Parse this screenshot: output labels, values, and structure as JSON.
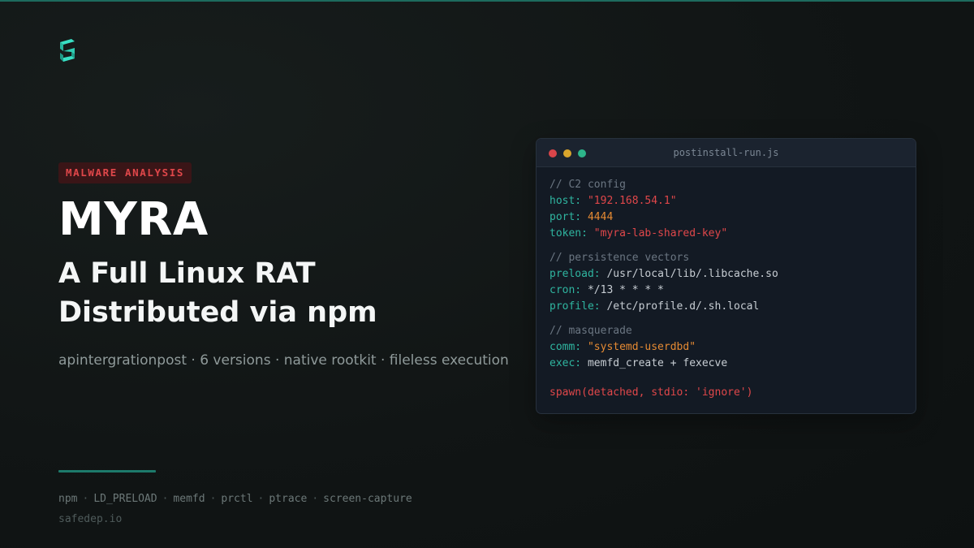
{
  "brand": {
    "logo_icon": "safedep-logo-icon",
    "accent_color": "#1d7a6b"
  },
  "tag": "MALWARE ANALYSIS",
  "title": "MYRA",
  "subtitle": [
    "A Full Linux RAT",
    "Distributed via npm"
  ],
  "meta": "apintergrationpost · 6 versions · native rootkit · fileless execution",
  "techs": [
    "npm",
    "LD_PRELOAD",
    "memfd",
    "prctl",
    "ptrace",
    "screen-capture"
  ],
  "techs_separator": "·",
  "site": "safedep.io",
  "code_window": {
    "filename": "postinstall-run.js",
    "sections": [
      {
        "comment": "// C2 config",
        "lines": [
          {
            "key": "host:",
            "value": "\"192.168.54.1\"",
            "kind": "str"
          },
          {
            "key": "port:",
            "value": "4444",
            "kind": "num"
          },
          {
            "key": "token:",
            "value": "\"myra-lab-shared-key\"",
            "kind": "str"
          }
        ]
      },
      {
        "comment": "// persistence vectors",
        "lines": [
          {
            "key": "preload:",
            "value": "/usr/local/lib/.libcache.so",
            "kind": "plain"
          },
          {
            "key": "cron:",
            "value": "*/13 * * * *",
            "kind": "plain"
          },
          {
            "key": "profile:",
            "value": "/etc/profile.d/.sh.local",
            "kind": "plain"
          }
        ]
      },
      {
        "comment": "// masquerade",
        "lines": [
          {
            "key": "comm:",
            "value": "\"systemd-userdbd\"",
            "kind": "orange"
          },
          {
            "key": "exec:",
            "value": "memfd_create + fexecve",
            "kind": "plain"
          }
        ]
      }
    ],
    "final_line": "spawn(detached, stdio: 'ignore')"
  }
}
